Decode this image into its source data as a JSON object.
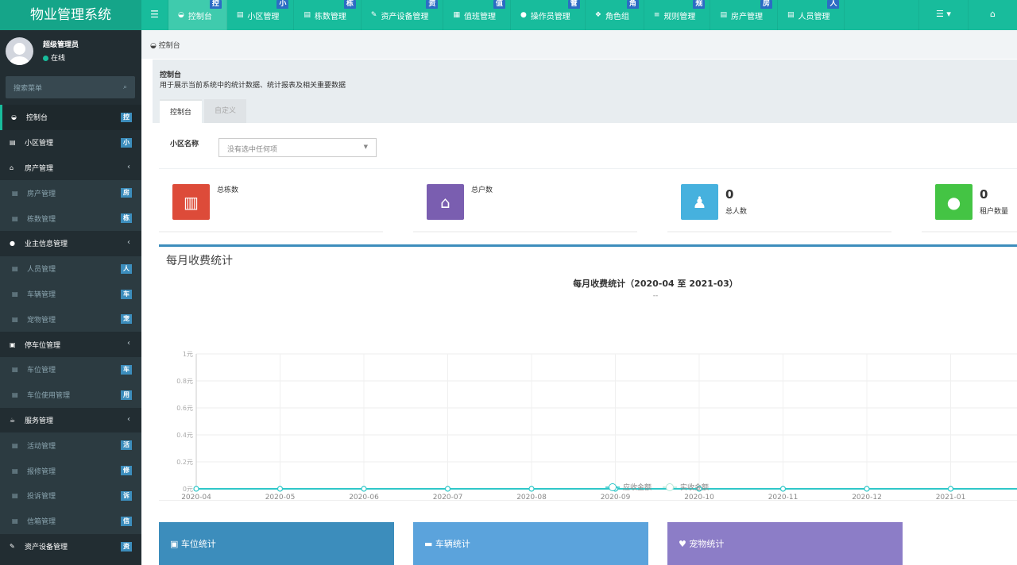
{
  "brand": "物业管理系统",
  "topnav": [
    {
      "label": "控制台",
      "icon": "dashboard-icon",
      "badge": "控",
      "active": true
    },
    {
      "label": "小区管理",
      "icon": "table-icon",
      "badge": "小"
    },
    {
      "label": "栋数管理",
      "icon": "table-icon",
      "badge": "栋"
    },
    {
      "label": "资产设备管理",
      "icon": "wrench-icon",
      "badge": "资"
    },
    {
      "label": "值班管理",
      "icon": "calendar-icon",
      "badge": "值"
    },
    {
      "label": "操作员管理",
      "icon": "user-icon",
      "badge": "管"
    },
    {
      "label": "角色组",
      "icon": "group-icon",
      "badge": "角"
    },
    {
      "label": "规则管理",
      "icon": "list-icon",
      "badge": "规"
    },
    {
      "label": "房产管理",
      "icon": "table-icon",
      "badge": "房"
    },
    {
      "label": "人员管理",
      "icon": "table-icon",
      "badge": "人"
    }
  ],
  "topright": {
    "menu_icon": "list-caret-icon",
    "home_icon": "home-icon"
  },
  "user": {
    "name": "超级管理员",
    "status": "在线"
  },
  "search": {
    "placeholder": "搜索菜单"
  },
  "menu": [
    {
      "label": "控制台",
      "icon": "dashboard-icon",
      "badge": "控",
      "type": "top",
      "active": true
    },
    {
      "label": "小区管理",
      "icon": "table-icon",
      "badge": "小",
      "type": "top"
    },
    {
      "label": "房产管理",
      "icon": "home-icon",
      "arrow": "‹",
      "type": "top"
    },
    {
      "label": "房产管理",
      "icon": "table-icon",
      "badge": "房",
      "type": "sub"
    },
    {
      "label": "栋数管理",
      "icon": "table-icon",
      "badge": "栋",
      "type": "sub"
    },
    {
      "label": "业主信息管理",
      "icon": "user-icon",
      "arrow": "‹",
      "type": "top"
    },
    {
      "label": "人员管理",
      "icon": "table-icon",
      "badge": "人",
      "type": "sub"
    },
    {
      "label": "车辆管理",
      "icon": "table-icon",
      "badge": "车",
      "type": "sub"
    },
    {
      "label": "宠物管理",
      "icon": "table-icon",
      "badge": "宠",
      "type": "sub"
    },
    {
      "label": "停车位管理",
      "icon": "film-icon",
      "arrow": "‹",
      "type": "top"
    },
    {
      "label": "车位管理",
      "icon": "table-icon",
      "badge": "车",
      "type": "sub"
    },
    {
      "label": "车位使用管理",
      "icon": "table-icon",
      "badge": "用",
      "type": "sub"
    },
    {
      "label": "服务管理",
      "icon": "coffee-icon",
      "arrow": "‹",
      "type": "top"
    },
    {
      "label": "活动管理",
      "icon": "table-icon",
      "badge": "活",
      "type": "sub"
    },
    {
      "label": "报修管理",
      "icon": "table-icon",
      "badge": "修",
      "type": "sub"
    },
    {
      "label": "投诉管理",
      "icon": "table-icon",
      "badge": "诉",
      "type": "sub"
    },
    {
      "label": "信箱管理",
      "icon": "table-icon",
      "badge": "信",
      "type": "sub"
    },
    {
      "label": "资产设备管理",
      "icon": "wrench-icon",
      "badge": "资",
      "type": "top"
    }
  ],
  "breadcrumb": "控制台",
  "header": {
    "title": "控制台",
    "desc": "用于展示当前系统中的统计数据、统计报表及相关重要数据",
    "tabs": [
      "控制台",
      "自定义"
    ]
  },
  "filter": {
    "label": "小区名称",
    "placeholder": "没有选中任何项"
  },
  "stats": [
    {
      "label": "总栋数",
      "value": "",
      "color": "#dd4b39",
      "icon": "building-icon"
    },
    {
      "label": "总户数",
      "value": "",
      "color": "#7a5eb0",
      "icon": "home-icon"
    },
    {
      "label": "总人数",
      "value": "0",
      "color": "#46b1de",
      "icon": "person-icon"
    },
    {
      "label": "租户数量",
      "value": "0",
      "color": "#44c444",
      "icon": "user-icon"
    }
  ],
  "panel_title": "每月收费统计",
  "chart_data": {
    "type": "line",
    "title": "每月收费统计（2020-04 至 2021-03）",
    "subtitle": "--",
    "categories": [
      "2020-04",
      "2020-05",
      "2020-06",
      "2020-07",
      "2020-08",
      "2020-09",
      "2020-10",
      "2020-11",
      "2020-12",
      "2021-01"
    ],
    "y_ticks": [
      "0元",
      "0.2元",
      "0.4元",
      "0.6元",
      "0.8元",
      "1元"
    ],
    "ylim": [
      0,
      1
    ],
    "series": [
      {
        "name": "应收金额",
        "color": "#2ec7c9",
        "values": [
          0,
          0,
          0,
          0,
          0,
          0,
          0,
          0,
          0,
          0
        ]
      },
      {
        "name": "实收金额",
        "color": "#b6e8d8",
        "values": [
          0,
          0,
          0,
          0,
          0,
          0,
          0,
          0,
          0,
          0
        ]
      }
    ]
  },
  "bottom_cards": [
    {
      "label": "车位统计",
      "icon": "film-icon"
    },
    {
      "label": "车辆统计",
      "icon": "truck-icon"
    },
    {
      "label": "宠物统计",
      "icon": "heart-icon"
    }
  ]
}
